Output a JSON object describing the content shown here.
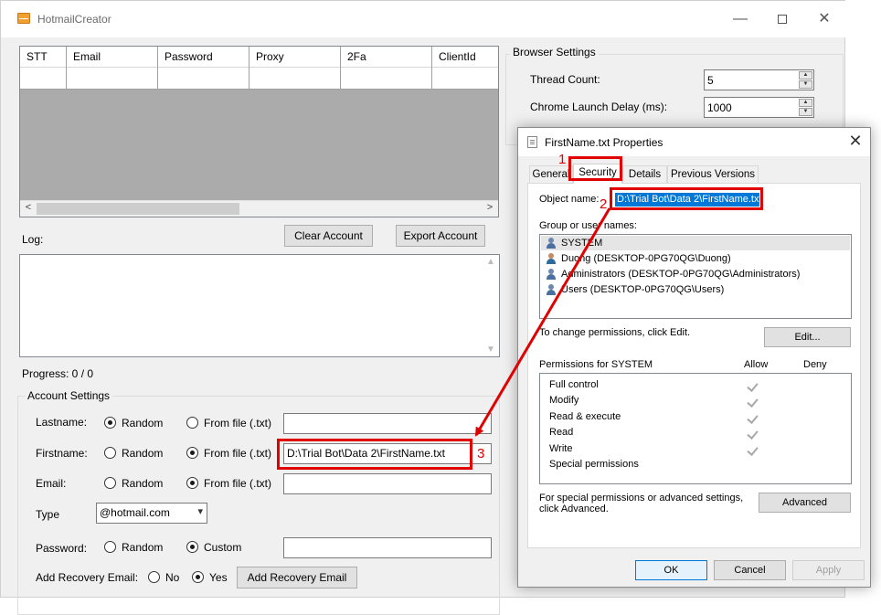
{
  "main_window": {
    "title": "HotmailCreator",
    "controls": {
      "minimize": "—",
      "close": "✕"
    },
    "grid": {
      "columns": [
        "STT",
        "Email",
        "Password",
        "Proxy",
        "2Fa",
        "ClientId"
      ],
      "scroll_left": "<",
      "scroll_right": ">"
    },
    "buttons": {
      "clear_account": "Clear Account",
      "export_account": "Export Account"
    },
    "log_label": "Log:",
    "progress": "Progress: 0 / 0",
    "account_settings": {
      "legend": "Account Settings",
      "lastname": {
        "label": "Lastname:",
        "opt_random": "Random",
        "opt_file": "From file (.txt)",
        "selected": "random",
        "value": ""
      },
      "firstname": {
        "label": "Firstname:",
        "opt_random": "Random",
        "opt_file": "From file (.txt)",
        "selected": "file",
        "value": "D:\\Trial Bot\\Data 2\\FirstName.txt"
      },
      "email": {
        "label": "Email:",
        "opt_random": "Random",
        "opt_file": "From file (.txt)",
        "selected": "file",
        "value": ""
      },
      "type": {
        "label": "Type",
        "value": "@hotmail.com"
      },
      "password": {
        "label": "Password:",
        "opt_random": "Random",
        "opt_custom": "Custom",
        "selected": "custom",
        "value": ""
      },
      "recovery": {
        "label": "Add Recovery Email:",
        "opt_no": "No",
        "opt_yes": "Yes",
        "selected": "yes",
        "button": "Add Recovery Email"
      }
    },
    "browser_settings": {
      "legend": "Browser Settings",
      "thread_count": {
        "label": "Thread Count:",
        "value": "5"
      },
      "chrome_launch_delay": {
        "label": "Chrome Launch Delay (ms):",
        "value": "1000"
      }
    }
  },
  "dialog": {
    "title": "FirstName.txt Properties",
    "close": "✕",
    "tabs": [
      "General",
      "Security",
      "Details",
      "Previous Versions"
    ],
    "active_tab": "Security",
    "object_name_label": "Object name:",
    "object_name_value": "D:\\Trial Bot\\Data 2\\FirstName.txt",
    "group_label": "Group or user names:",
    "users": [
      "SYSTEM",
      "Duong (DESKTOP-0PG70QG\\Duong)",
      "Administrators (DESKTOP-0PG70QG\\Administrators)",
      "Users (DESKTOP-0PG70QG\\Users)"
    ],
    "change_perm_text": "To change permissions, click Edit.",
    "edit_button": "Edit...",
    "permissions_label": "Permissions for SYSTEM",
    "allow_label": "Allow",
    "deny_label": "Deny",
    "permissions": [
      "Full control",
      "Modify",
      "Read & execute",
      "Read",
      "Write",
      "Special permissions"
    ],
    "special_text_1": "For special permissions or advanced settings,",
    "special_text_2": "click Advanced.",
    "advanced_button": "Advanced",
    "ok_button": "OK",
    "cancel_button": "Cancel",
    "apply_button": "Apply"
  },
  "annotations": {
    "step1": "1",
    "step2": "2",
    "step3": "3",
    "color": "#e00000"
  }
}
